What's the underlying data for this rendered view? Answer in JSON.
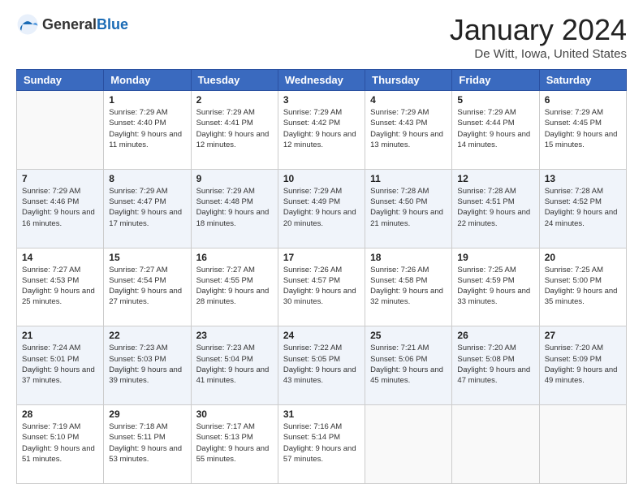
{
  "header": {
    "logo_general": "General",
    "logo_blue": "Blue",
    "month_title": "January 2024",
    "location": "De Witt, Iowa, United States"
  },
  "weekdays": [
    "Sunday",
    "Monday",
    "Tuesday",
    "Wednesday",
    "Thursday",
    "Friday",
    "Saturday"
  ],
  "weeks": [
    [
      {
        "day": "",
        "sunrise": "",
        "sunset": "",
        "daylight": ""
      },
      {
        "day": "1",
        "sunrise": "Sunrise: 7:29 AM",
        "sunset": "Sunset: 4:40 PM",
        "daylight": "Daylight: 9 hours and 11 minutes."
      },
      {
        "day": "2",
        "sunrise": "Sunrise: 7:29 AM",
        "sunset": "Sunset: 4:41 PM",
        "daylight": "Daylight: 9 hours and 12 minutes."
      },
      {
        "day": "3",
        "sunrise": "Sunrise: 7:29 AM",
        "sunset": "Sunset: 4:42 PM",
        "daylight": "Daylight: 9 hours and 12 minutes."
      },
      {
        "day": "4",
        "sunrise": "Sunrise: 7:29 AM",
        "sunset": "Sunset: 4:43 PM",
        "daylight": "Daylight: 9 hours and 13 minutes."
      },
      {
        "day": "5",
        "sunrise": "Sunrise: 7:29 AM",
        "sunset": "Sunset: 4:44 PM",
        "daylight": "Daylight: 9 hours and 14 minutes."
      },
      {
        "day": "6",
        "sunrise": "Sunrise: 7:29 AM",
        "sunset": "Sunset: 4:45 PM",
        "daylight": "Daylight: 9 hours and 15 minutes."
      }
    ],
    [
      {
        "day": "7",
        "sunrise": "Sunrise: 7:29 AM",
        "sunset": "Sunset: 4:46 PM",
        "daylight": "Daylight: 9 hours and 16 minutes."
      },
      {
        "day": "8",
        "sunrise": "Sunrise: 7:29 AM",
        "sunset": "Sunset: 4:47 PM",
        "daylight": "Daylight: 9 hours and 17 minutes."
      },
      {
        "day": "9",
        "sunrise": "Sunrise: 7:29 AM",
        "sunset": "Sunset: 4:48 PM",
        "daylight": "Daylight: 9 hours and 18 minutes."
      },
      {
        "day": "10",
        "sunrise": "Sunrise: 7:29 AM",
        "sunset": "Sunset: 4:49 PM",
        "daylight": "Daylight: 9 hours and 20 minutes."
      },
      {
        "day": "11",
        "sunrise": "Sunrise: 7:28 AM",
        "sunset": "Sunset: 4:50 PM",
        "daylight": "Daylight: 9 hours and 21 minutes."
      },
      {
        "day": "12",
        "sunrise": "Sunrise: 7:28 AM",
        "sunset": "Sunset: 4:51 PM",
        "daylight": "Daylight: 9 hours and 22 minutes."
      },
      {
        "day": "13",
        "sunrise": "Sunrise: 7:28 AM",
        "sunset": "Sunset: 4:52 PM",
        "daylight": "Daylight: 9 hours and 24 minutes."
      }
    ],
    [
      {
        "day": "14",
        "sunrise": "Sunrise: 7:27 AM",
        "sunset": "Sunset: 4:53 PM",
        "daylight": "Daylight: 9 hours and 25 minutes."
      },
      {
        "day": "15",
        "sunrise": "Sunrise: 7:27 AM",
        "sunset": "Sunset: 4:54 PM",
        "daylight": "Daylight: 9 hours and 27 minutes."
      },
      {
        "day": "16",
        "sunrise": "Sunrise: 7:27 AM",
        "sunset": "Sunset: 4:55 PM",
        "daylight": "Daylight: 9 hours and 28 minutes."
      },
      {
        "day": "17",
        "sunrise": "Sunrise: 7:26 AM",
        "sunset": "Sunset: 4:57 PM",
        "daylight": "Daylight: 9 hours and 30 minutes."
      },
      {
        "day": "18",
        "sunrise": "Sunrise: 7:26 AM",
        "sunset": "Sunset: 4:58 PM",
        "daylight": "Daylight: 9 hours and 32 minutes."
      },
      {
        "day": "19",
        "sunrise": "Sunrise: 7:25 AM",
        "sunset": "Sunset: 4:59 PM",
        "daylight": "Daylight: 9 hours and 33 minutes."
      },
      {
        "day": "20",
        "sunrise": "Sunrise: 7:25 AM",
        "sunset": "Sunset: 5:00 PM",
        "daylight": "Daylight: 9 hours and 35 minutes."
      }
    ],
    [
      {
        "day": "21",
        "sunrise": "Sunrise: 7:24 AM",
        "sunset": "Sunset: 5:01 PM",
        "daylight": "Daylight: 9 hours and 37 minutes."
      },
      {
        "day": "22",
        "sunrise": "Sunrise: 7:23 AM",
        "sunset": "Sunset: 5:03 PM",
        "daylight": "Daylight: 9 hours and 39 minutes."
      },
      {
        "day": "23",
        "sunrise": "Sunrise: 7:23 AM",
        "sunset": "Sunset: 5:04 PM",
        "daylight": "Daylight: 9 hours and 41 minutes."
      },
      {
        "day": "24",
        "sunrise": "Sunrise: 7:22 AM",
        "sunset": "Sunset: 5:05 PM",
        "daylight": "Daylight: 9 hours and 43 minutes."
      },
      {
        "day": "25",
        "sunrise": "Sunrise: 7:21 AM",
        "sunset": "Sunset: 5:06 PM",
        "daylight": "Daylight: 9 hours and 45 minutes."
      },
      {
        "day": "26",
        "sunrise": "Sunrise: 7:20 AM",
        "sunset": "Sunset: 5:08 PM",
        "daylight": "Daylight: 9 hours and 47 minutes."
      },
      {
        "day": "27",
        "sunrise": "Sunrise: 7:20 AM",
        "sunset": "Sunset: 5:09 PM",
        "daylight": "Daylight: 9 hours and 49 minutes."
      }
    ],
    [
      {
        "day": "28",
        "sunrise": "Sunrise: 7:19 AM",
        "sunset": "Sunset: 5:10 PM",
        "daylight": "Daylight: 9 hours and 51 minutes."
      },
      {
        "day": "29",
        "sunrise": "Sunrise: 7:18 AM",
        "sunset": "Sunset: 5:11 PM",
        "daylight": "Daylight: 9 hours and 53 minutes."
      },
      {
        "day": "30",
        "sunrise": "Sunrise: 7:17 AM",
        "sunset": "Sunset: 5:13 PM",
        "daylight": "Daylight: 9 hours and 55 minutes."
      },
      {
        "day": "31",
        "sunrise": "Sunrise: 7:16 AM",
        "sunset": "Sunset: 5:14 PM",
        "daylight": "Daylight: 9 hours and 57 minutes."
      },
      {
        "day": "",
        "sunrise": "",
        "sunset": "",
        "daylight": ""
      },
      {
        "day": "",
        "sunrise": "",
        "sunset": "",
        "daylight": ""
      },
      {
        "day": "",
        "sunrise": "",
        "sunset": "",
        "daylight": ""
      }
    ]
  ]
}
